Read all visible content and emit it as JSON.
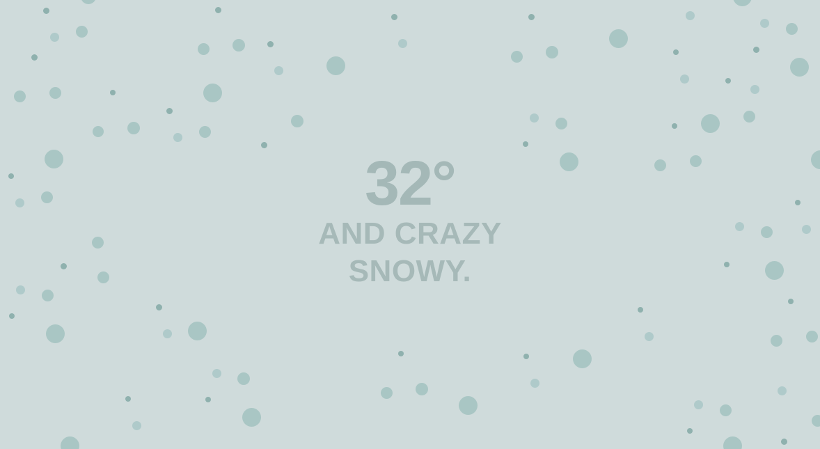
{
  "weather": {
    "temperature": "32°",
    "line1": "AND CRAZY",
    "line2": "SNOWY."
  },
  "colors": {
    "background": "#cfdbdb",
    "text": "#a6b9b8",
    "flake_small": "#8fb1ae",
    "flake_medium": "#afcaca",
    "flake_large": "#a9c6c4"
  },
  "decor": {
    "pattern": "snowflake-dots"
  }
}
